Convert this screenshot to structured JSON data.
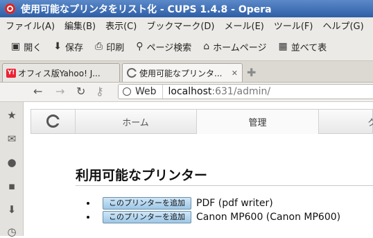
{
  "window": {
    "title": "使用可能なプリンタをリスト化 - CUPS 1.4.8 - Opera"
  },
  "menubar": {
    "items": [
      "ファイル(A)",
      "編集(B)",
      "表示(C)",
      "ブックマーク(D)",
      "メール(E)",
      "ツール(F)",
      "ヘルプ(G)"
    ]
  },
  "toolbar": {
    "buttons": [
      {
        "label": "開く",
        "icon": "folder-icon"
      },
      {
        "label": "保存",
        "icon": "save-icon"
      },
      {
        "label": "印刷",
        "icon": "printer-icon"
      },
      {
        "label": "ページ検索",
        "icon": "search-icon"
      },
      {
        "label": "ホームページ",
        "icon": "home-icon"
      },
      {
        "label": "並べて表",
        "icon": "tile-icon"
      }
    ]
  },
  "tabs": [
    {
      "label": "オフィス版Yahoo! J...",
      "active": false,
      "icon": "yahoo-icon"
    },
    {
      "label": "使用可能なプリンタ...",
      "active": true,
      "icon": "cups-icon"
    }
  ],
  "address": {
    "site_label": "Web",
    "url_host": "localhost",
    "url_rest": ":631/admin/"
  },
  "cups_nav": {
    "tabs": [
      "ホーム",
      "管理",
      "ク"
    ],
    "active": "管理"
  },
  "page": {
    "heading": "利用可能なプリンター",
    "add_button_label": "このプリンターを追加",
    "printers": [
      {
        "name": "PDF (pdf writer)"
      },
      {
        "name": "Canon MP600 (Canon MP600)"
      }
    ]
  },
  "colors": {
    "titlebar": "#2e5ea6",
    "chrome": "#eceae6",
    "button_blue": "#9dc8e8"
  }
}
